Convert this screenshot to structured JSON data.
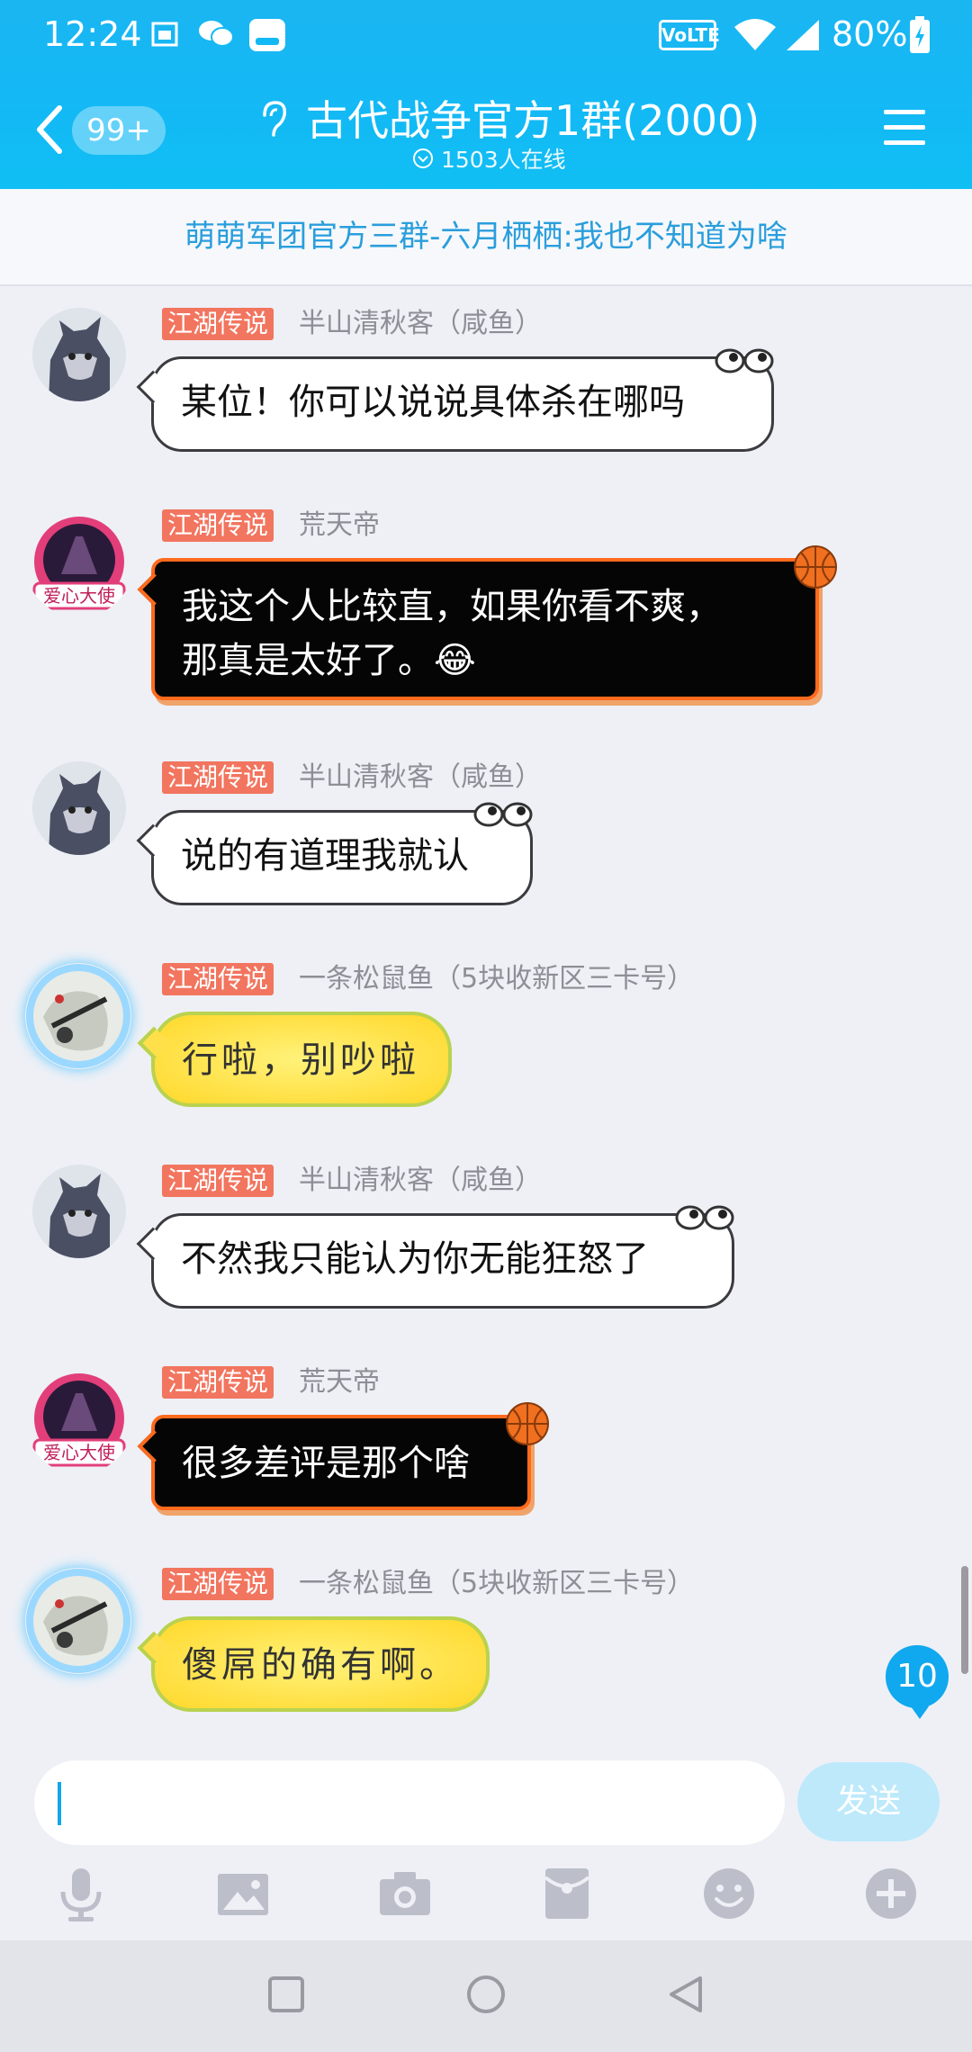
{
  "status_bar": {
    "time": "12:24",
    "network": "VoLTE",
    "battery": "80%"
  },
  "header": {
    "unread_count": "99+",
    "title": "古代战争官方1群(2000)",
    "online": "1503人在线"
  },
  "announcement": "萌萌军团官方三群-六月栖栖:我也不知道为啥",
  "messages": [
    {
      "badge": "江湖传说",
      "sender": "半山清秋客（咸鱼）",
      "lines": [
        "某位！你可以说说具体杀在哪吗"
      ]
    },
    {
      "badge": "江湖传说",
      "sender": "荒天帝",
      "lines": [
        "我这个人比较直，如果你看不爽，",
        "那真是太好了。😂"
      ]
    },
    {
      "badge": "江湖传说",
      "sender": "半山清秋客（咸鱼）",
      "lines": [
        "说的有道理我就认"
      ]
    },
    {
      "badge": "江湖传说",
      "sender": "一条松鼠鱼（5块收新区三卡号）",
      "lines": [
        "行啦，别吵啦"
      ]
    },
    {
      "badge": "江湖传说",
      "sender": "半山清秋客（咸鱼）",
      "lines": [
        "不然我只能认为你无能狂怒了"
      ]
    },
    {
      "badge": "江湖传说",
      "sender": "荒天帝",
      "lines": [
        "很多差评是那个啥"
      ]
    },
    {
      "badge": "江湖传说",
      "sender": "一条松鼠鱼（5块收新区三卡号）",
      "lines": [
        "傻屌的确有啊。"
      ]
    }
  ],
  "new_message_count": "10",
  "input": {
    "value": "",
    "send_label": "发送"
  },
  "toolbar_icons": [
    "microphone-icon",
    "image-icon",
    "camera-icon",
    "red-packet-icon",
    "emoji-icon",
    "plus-icon"
  ],
  "colors": {
    "header": "#13b9f5",
    "badge": "#f2755f",
    "accent": "#10a8ee"
  }
}
